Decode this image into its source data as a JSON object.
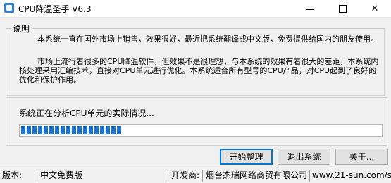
{
  "window": {
    "title": "CPU降温圣手 V6.3",
    "controls": {
      "minimize": "minimize",
      "maximize": "maximize",
      "close": "✕"
    }
  },
  "description": {
    "group_title": "说明",
    "paragraph1": "本系统一直在国外市场上销售，效果很好，最近把系统翻译成中文版，免费提供给国内的朋友使用。",
    "paragraph2": "市场上流行着很多的CPU降温软件，但效果不是很理想，与本系统的效果有着很大的差距，本系统内核处理采用汇编技术，直接对CPU单元进行优化。本系统适合所有型号的CPU产品，对CPU起到了良好的优化和保护作用。"
  },
  "progress": {
    "status_text": "系统正在分析CPU单元的实际情况...",
    "fraction": 0.29
  },
  "buttons": {
    "start": "开始整理",
    "exit": "退出系统",
    "about": "关于..."
  },
  "statusbar": {
    "version_label": "版本:",
    "version_value": "中文免费版",
    "developer_label": "开发商:",
    "developer_value": "烟台杰瑞网络商贸有限公司",
    "website": "www.21-sun.com/s"
  },
  "colors": {
    "progress_fill": "#1c71c8",
    "primary_button_border": "#0078d7"
  },
  "icons": {
    "app": "app-icon"
  }
}
